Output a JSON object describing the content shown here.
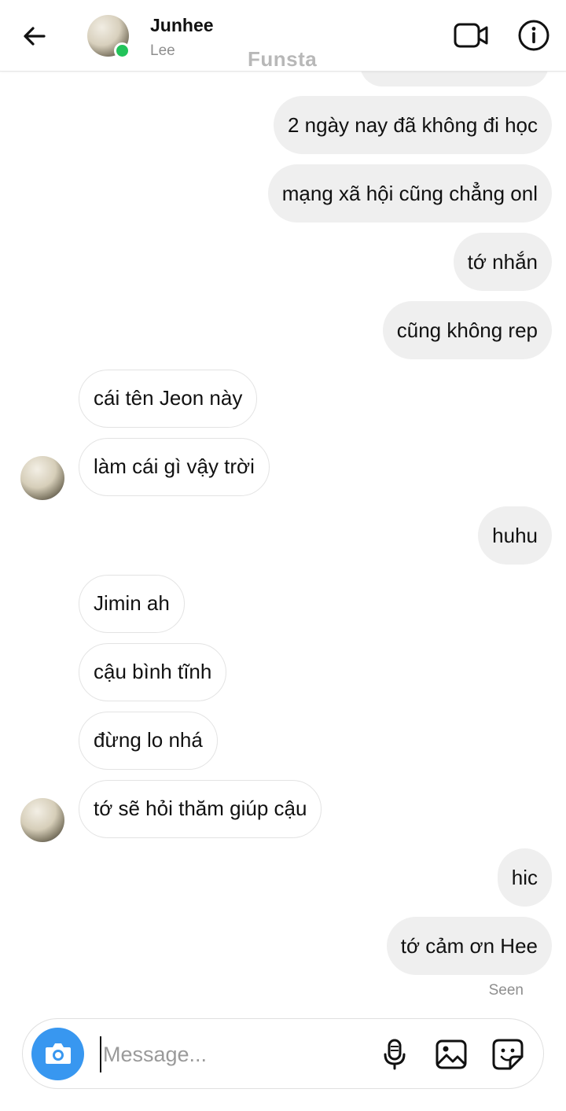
{
  "header": {
    "name": "Junhee",
    "subtitle": "Lee",
    "watermark": "Funsta",
    "icons": [
      "back-arrow-icon",
      "video-call-icon",
      "info-icon"
    ],
    "online_color": "#22c35a"
  },
  "messages": [
    {
      "from": "me",
      "text": "2 ngày nay đã không đi học"
    },
    {
      "from": "me",
      "text": "mạng xã hội cũng chẳng onl"
    },
    {
      "from": "me",
      "text": "tớ nhắn"
    },
    {
      "from": "me",
      "text": "cũng không rep"
    },
    {
      "from": "them",
      "text": "cái tên Jeon này"
    },
    {
      "from": "them",
      "text": "làm cái gì vậy trời"
    },
    {
      "from": "me",
      "text": "huhu"
    },
    {
      "from": "them",
      "text": "Jimin ah"
    },
    {
      "from": "them",
      "text": "cậu bình tĩnh"
    },
    {
      "from": "them",
      "text": "đừng lo nhá"
    },
    {
      "from": "them",
      "text": "tớ sẽ hỏi thăm giúp cậu"
    },
    {
      "from": "me",
      "text": "hic"
    },
    {
      "from": "me",
      "text": "tớ cảm ơn Hee"
    }
  ],
  "status": {
    "seen": "Seen"
  },
  "composer": {
    "placeholder": "Message...",
    "accent": "#3897f0",
    "icons": [
      "camera-icon",
      "microphone-icon",
      "gallery-icon",
      "sticker-icon"
    ]
  }
}
